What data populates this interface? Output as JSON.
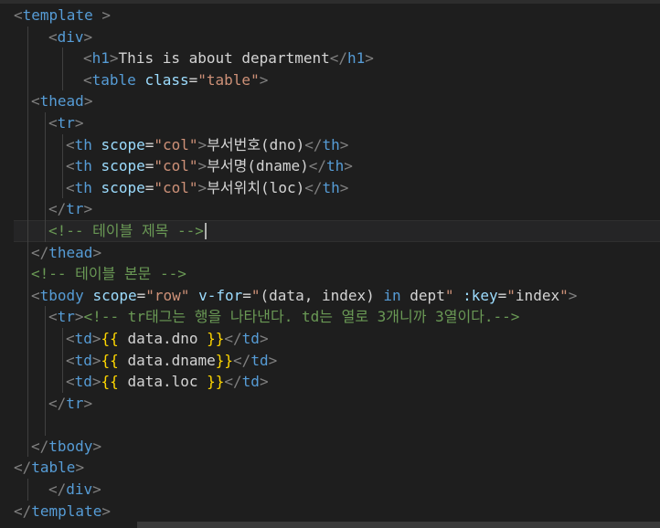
{
  "editor": {
    "lines": [
      {
        "id": "l1",
        "tokens": [
          [
            "punc",
            "<"
          ],
          [
            "tag",
            "template"
          ],
          [
            "txt",
            " "
          ],
          [
            "punc",
            ">"
          ]
        ]
      },
      {
        "id": "l2",
        "tokens": [
          [
            "punc",
            "<"
          ],
          [
            "tag",
            "div"
          ],
          [
            "punc",
            ">"
          ]
        ]
      },
      {
        "id": "l3",
        "tokens": [
          [
            "punc",
            "<"
          ],
          [
            "tag",
            "h1"
          ],
          [
            "punc",
            ">"
          ],
          [
            "txt",
            "This is about department"
          ],
          [
            "punc",
            "</"
          ],
          [
            "tag",
            "h1"
          ],
          [
            "punc",
            ">"
          ]
        ]
      },
      {
        "id": "l4",
        "tokens": [
          [
            "punc",
            "<"
          ],
          [
            "tag",
            "table"
          ],
          [
            "txt",
            " "
          ],
          [
            "attr",
            "class"
          ],
          [
            "txt",
            "="
          ],
          [
            "str",
            "\"table\""
          ],
          [
            "punc",
            ">"
          ]
        ]
      },
      {
        "id": "l5",
        "tokens": [
          [
            "punc",
            "<"
          ],
          [
            "tag",
            "thead"
          ],
          [
            "punc",
            ">"
          ]
        ]
      },
      {
        "id": "l6",
        "tokens": [
          [
            "punc",
            "<"
          ],
          [
            "tag",
            "tr"
          ],
          [
            "punc",
            ">"
          ]
        ]
      },
      {
        "id": "l7",
        "tokens": [
          [
            "punc",
            "<"
          ],
          [
            "tag",
            "th"
          ],
          [
            "txt",
            " "
          ],
          [
            "attr",
            "scope"
          ],
          [
            "txt",
            "="
          ],
          [
            "str",
            "\"col\""
          ],
          [
            "punc",
            ">"
          ],
          [
            "txt",
            "부서번호(dno)"
          ],
          [
            "punc",
            "</"
          ],
          [
            "tag",
            "th"
          ],
          [
            "punc",
            ">"
          ]
        ]
      },
      {
        "id": "l8",
        "tokens": [
          [
            "punc",
            "<"
          ],
          [
            "tag",
            "th"
          ],
          [
            "txt",
            " "
          ],
          [
            "attr",
            "scope"
          ],
          [
            "txt",
            "="
          ],
          [
            "str",
            "\"col\""
          ],
          [
            "punc",
            ">"
          ],
          [
            "txt",
            "부서명(dname)"
          ],
          [
            "punc",
            "</"
          ],
          [
            "tag",
            "th"
          ],
          [
            "punc",
            ">"
          ]
        ]
      },
      {
        "id": "l9",
        "tokens": [
          [
            "punc",
            "<"
          ],
          [
            "tag",
            "th"
          ],
          [
            "txt",
            " "
          ],
          [
            "attr",
            "scope"
          ],
          [
            "txt",
            "="
          ],
          [
            "str",
            "\"col\""
          ],
          [
            "punc",
            ">"
          ],
          [
            "txt",
            "부서위치(loc)"
          ],
          [
            "punc",
            "</"
          ],
          [
            "tag",
            "th"
          ],
          [
            "punc",
            ">"
          ]
        ]
      },
      {
        "id": "l10",
        "tokens": [
          [
            "punc",
            "</"
          ],
          [
            "tag",
            "tr"
          ],
          [
            "punc",
            ">"
          ]
        ]
      },
      {
        "id": "l11",
        "tokens": [
          [
            "com",
            "<!-- 테이블 제목 -->"
          ]
        ]
      },
      {
        "id": "l12",
        "tokens": [
          [
            "punc",
            "</"
          ],
          [
            "tag",
            "thead"
          ],
          [
            "punc",
            ">"
          ]
        ]
      },
      {
        "id": "l13",
        "tokens": [
          [
            "com",
            "<!-- 테이블 본문 -->"
          ]
        ]
      },
      {
        "id": "l14",
        "tokens": [
          [
            "punc",
            "<"
          ],
          [
            "tag",
            "tbody"
          ],
          [
            "txt",
            " "
          ],
          [
            "attr",
            "scope"
          ],
          [
            "txt",
            "="
          ],
          [
            "str",
            "\"row\""
          ],
          [
            "txt",
            " "
          ],
          [
            "attr",
            "v-for"
          ],
          [
            "txt",
            "="
          ],
          [
            "str",
            "\""
          ],
          [
            "txt",
            "(data, index) "
          ],
          [
            "tag",
            "in"
          ],
          [
            "txt",
            " dept"
          ],
          [
            "str",
            "\""
          ],
          [
            "txt",
            " "
          ],
          [
            "attr",
            ":key"
          ],
          [
            "txt",
            "="
          ],
          [
            "str",
            "\""
          ],
          [
            "txt",
            "index"
          ],
          [
            "str",
            "\""
          ],
          [
            "punc",
            ">"
          ]
        ]
      },
      {
        "id": "l15",
        "tokens": [
          [
            "punc",
            "<"
          ],
          [
            "tag",
            "tr"
          ],
          [
            "punc",
            ">"
          ],
          [
            "com",
            "<!-- tr태그는 행을 나타낸다. td는 열로 3개니까 3열이다.-->"
          ]
        ]
      },
      {
        "id": "l16",
        "tokens": [
          [
            "punc",
            "<"
          ],
          [
            "tag",
            "td"
          ],
          [
            "punc",
            ">"
          ],
          [
            "mus",
            "{{"
          ],
          [
            "txt",
            " data.dno "
          ],
          [
            "mus",
            "}}"
          ],
          [
            "punc",
            "</"
          ],
          [
            "tag",
            "td"
          ],
          [
            "punc",
            ">"
          ]
        ]
      },
      {
        "id": "l17",
        "tokens": [
          [
            "punc",
            "<"
          ],
          [
            "tag",
            "td"
          ],
          [
            "punc",
            ">"
          ],
          [
            "mus",
            "{{"
          ],
          [
            "txt",
            " data.dname"
          ],
          [
            "mus",
            "}}"
          ],
          [
            "punc",
            "</"
          ],
          [
            "tag",
            "td"
          ],
          [
            "punc",
            ">"
          ]
        ]
      },
      {
        "id": "l18",
        "tokens": [
          [
            "punc",
            "<"
          ],
          [
            "tag",
            "td"
          ],
          [
            "punc",
            ">"
          ],
          [
            "mus",
            "{{"
          ],
          [
            "txt",
            " data.loc "
          ],
          [
            "mus",
            "}}"
          ],
          [
            "punc",
            "</"
          ],
          [
            "tag",
            "td"
          ],
          [
            "punc",
            ">"
          ]
        ]
      },
      {
        "id": "l19",
        "tokens": [
          [
            "punc",
            "</"
          ],
          [
            "tag",
            "tr"
          ],
          [
            "punc",
            ">"
          ]
        ]
      },
      {
        "id": "l20",
        "tokens": []
      },
      {
        "id": "l21",
        "tokens": [
          [
            "punc",
            "</"
          ],
          [
            "tag",
            "tbody"
          ],
          [
            "punc",
            ">"
          ]
        ]
      },
      {
        "id": "l22",
        "tokens": [
          [
            "punc",
            "</"
          ],
          [
            "tag",
            "table"
          ],
          [
            "punc",
            ">"
          ]
        ]
      },
      {
        "id": "l23",
        "tokens": [
          [
            "punc",
            "</"
          ],
          [
            "tag",
            "div"
          ],
          [
            "punc",
            ">"
          ]
        ]
      },
      {
        "id": "l24",
        "tokens": [
          [
            "punc",
            "</"
          ],
          [
            "tag",
            "template"
          ],
          [
            "punc",
            ">"
          ]
        ]
      }
    ]
  }
}
